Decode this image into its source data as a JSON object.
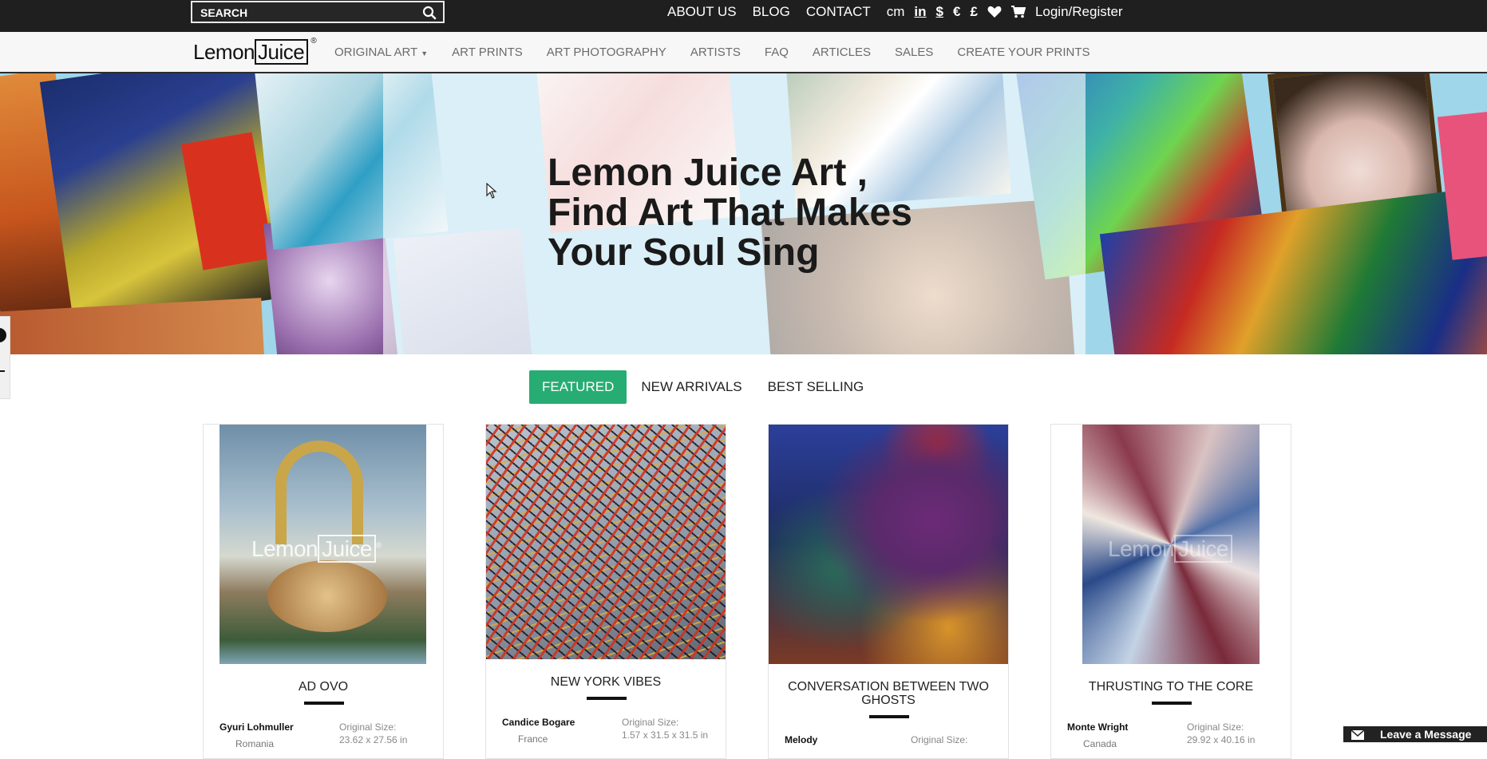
{
  "search": {
    "placeholder": "SEARCH"
  },
  "topnav": {
    "about": "ABOUT US",
    "blog": "BLOG",
    "contact": "CONTACT",
    "unit_cm": "cm",
    "unit_in": "in",
    "currency_usd": "$",
    "currency_eur": "€",
    "currency_gbp": "£",
    "login": "Login/Register"
  },
  "logo": {
    "part1": "Lemon",
    "part2": "Juice",
    "reg": "®"
  },
  "mainnav": {
    "items": [
      "ORIGINAL ART",
      "ART PRINTS",
      "ART PHOTOGRAPHY",
      "ARTISTS",
      "FAQ",
      "ARTICLES",
      "SALES",
      "CREATE YOUR PRINTS"
    ]
  },
  "hero": {
    "line1": "Lemon Juice Art ,",
    "line2": "Find Art That Makes",
    "line3": "Your Soul Sing"
  },
  "tabs": [
    "FEATURED",
    "NEW ARRIVALS",
    "BEST SELLING"
  ],
  "cards": [
    {
      "title": "AD OVO",
      "artist": "Gyuri Lohmuller",
      "country": "Romania",
      "size_label": "Original Size:",
      "size": "23.62 x 27.56 in"
    },
    {
      "title": "NEW YORK VIBES",
      "artist": "Candice Bogare",
      "country": "France",
      "size_label": "Original Size:",
      "size": "1.57 x 31.5 x 31.5 in"
    },
    {
      "title": "CONVERSATION BETWEEN TWO GHOSTS",
      "artist": "Melody",
      "country": "",
      "size_label": "Original Size:",
      "size": ""
    },
    {
      "title": "THRUSTING TO THE CORE",
      "artist": "Monte Wright",
      "country": "Canada",
      "size_label": "Original Size:",
      "size": "29.92 x 40.16 in"
    }
  ],
  "watermark": {
    "part1": "Lemon",
    "part2": "Juice",
    "reg": "®"
  },
  "chat": {
    "label": "Leave a Message"
  },
  "colors": {
    "accent": "#27ad73",
    "topbar": "#1f1f1f",
    "nav": "#f7f7f7"
  }
}
